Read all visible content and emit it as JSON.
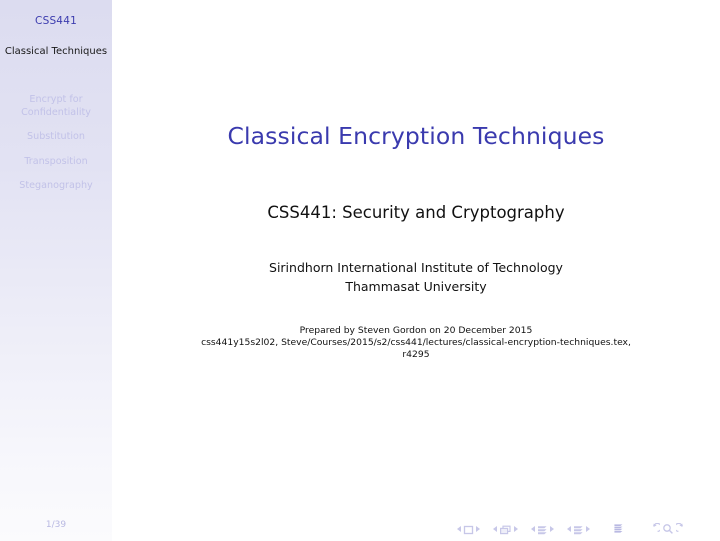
{
  "sidebar": {
    "course_code": "CSS441",
    "current_section": "Classical Techniques",
    "nav_items": [
      {
        "label": "Encrypt for Confidentiality",
        "active": false
      },
      {
        "label": "Substitution",
        "active": false
      },
      {
        "label": "Transposition",
        "active": false
      },
      {
        "label": "Steganography",
        "active": false
      }
    ],
    "page_number": "1/39"
  },
  "slide": {
    "title": "Classical Encryption Techniques",
    "subtitle": "CSS441: Security and Cryptography",
    "institute_line1": "Sirindhorn International Institute of Technology",
    "institute_line2": "Thammasat University",
    "prepared_by": "Prepared by Steven Gordon on 20 December 2015",
    "source_path": "css441y15s2l02, Steve/Courses/2015/s2/css441/lectures/classical-encryption-techniques.tex,",
    "revision": "r4295"
  },
  "navigation_symbols": {
    "first_slide": "previous-slide-icon",
    "slide": "slide-icon",
    "next_slide": "next-slide-icon",
    "previous_frame": "previous-frame-icon",
    "frame": "frame-icon",
    "next_frame": "next-frame-icon",
    "previous_subsection": "previous-subsection-icon",
    "subsection": "subsection-icon",
    "next_subsection": "next-subsection-icon",
    "previous_section": "previous-section-icon",
    "section": "section-icon",
    "next_section": "next-section-icon",
    "document": "document-icon",
    "back": "back-icon",
    "find": "search-icon",
    "forward": "forward-icon"
  },
  "colors": {
    "accent": "#3a3aae",
    "sidebar_inactive": "#c2c2e8",
    "sidebar_top": "#dcdcf0",
    "body_text": "#111111",
    "nav_symbol": "#c7c7e8"
  }
}
